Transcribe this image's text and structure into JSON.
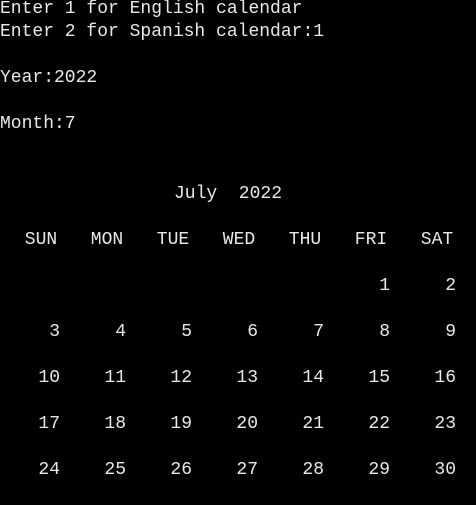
{
  "terminal": {
    "lines": [
      "Enter 1 for English calendar",
      "Enter 2 for Spanish calendar:1",
      "Year:2022",
      "Month:7"
    ]
  },
  "calendar": {
    "title": "July  2022",
    "weekdays": [
      "SUN",
      "MON",
      "TUE",
      "WED",
      "THU",
      "FRI",
      "SAT"
    ],
    "weeks": [
      [
        "",
        "",
        "",
        "",
        "",
        "1",
        "2"
      ],
      [
        "3",
        "4",
        "5",
        "6",
        "7",
        "8",
        "9"
      ],
      [
        "10",
        "11",
        "12",
        "13",
        "14",
        "15",
        "16"
      ],
      [
        "17",
        "18",
        "19",
        "20",
        "21",
        "22",
        "23"
      ],
      [
        "24",
        "25",
        "26",
        "27",
        "28",
        "29",
        "30"
      ]
    ]
  }
}
